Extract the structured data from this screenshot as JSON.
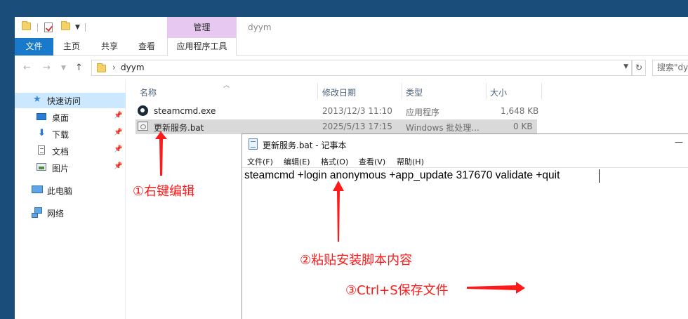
{
  "explorer": {
    "title": "dyym",
    "manage_tab": "管理",
    "ribbon_tabs": {
      "file": "文件",
      "home": "主页",
      "share": "共享",
      "view": "查看",
      "app_tools": "应用程序工具"
    },
    "address": {
      "path": "dyym",
      "search_placeholder": "搜索\"dyym\""
    },
    "nav_pane": {
      "quick_access": "快速访问",
      "desktop": "桌面",
      "downloads": "下载",
      "documents": "文档",
      "pictures": "图片",
      "this_pc": "此电脑",
      "network": "网络"
    },
    "columns": {
      "name": "名称",
      "modified": "修改日期",
      "type": "类型",
      "size": "大小"
    },
    "files": [
      {
        "name": "steamcmd.exe",
        "modified": "2013/12/3 11:10",
        "type": "应用程序",
        "size": "1,648 KB",
        "icon": "steam-icon",
        "selected": false
      },
      {
        "name": "更新服务.bat",
        "modified": "2025/5/13 17:15",
        "type": "Windows 批处理...",
        "size": "0 KB",
        "icon": "batch-file-icon",
        "selected": true
      }
    ]
  },
  "notepad": {
    "title": "更新服务.bat - 记事本",
    "menu": {
      "file": "文件(F)",
      "edit": "编辑(E)",
      "format": "格式(O)",
      "view": "查看(V)",
      "help": "帮助(H)"
    },
    "content": "steamcmd +login anonymous +app_update 317670 validate +quit"
  },
  "annotations": {
    "step1": "①右键编辑",
    "step2": "②粘贴安装脚本内容",
    "step3": "③Ctrl+S保存文件",
    "color": "#ff1a1a"
  },
  "colors": {
    "file_tab": "#1979ca",
    "manage_tab": "#e7c8f0",
    "selection": "#cce8ff",
    "selected_row": "#d9d9d9",
    "desktop_bg": "#1a4d7a"
  }
}
